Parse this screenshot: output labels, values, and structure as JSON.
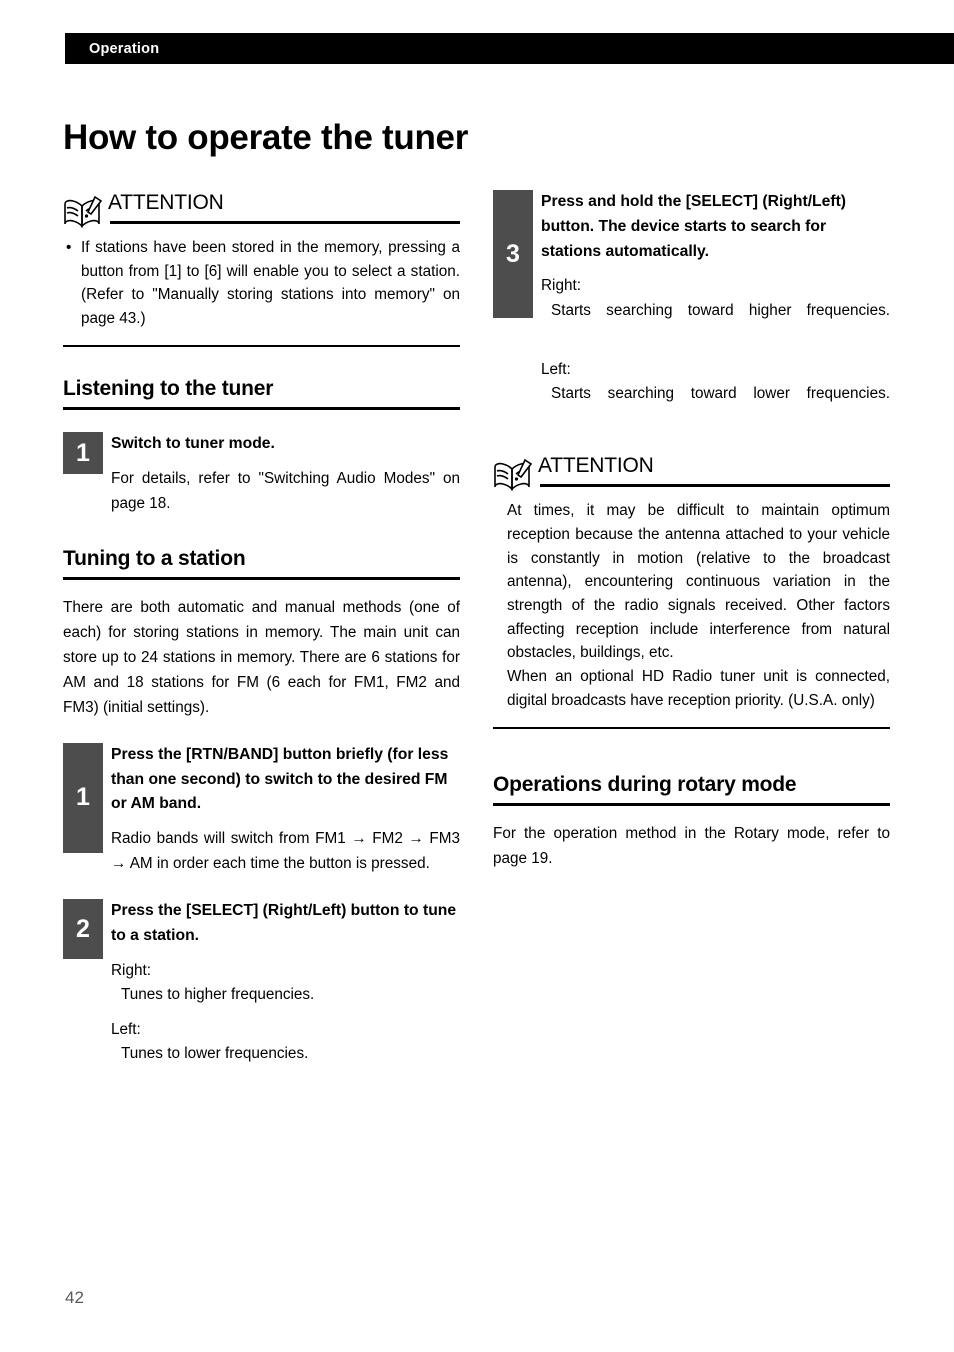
{
  "runhead": {
    "label": "Operation"
  },
  "page_title": "How to operate the tuner",
  "page_number": "42",
  "icons": {
    "attention": "open-book-exclamation-icon"
  },
  "left_column": {
    "attention": {
      "heading": "ATTENTION",
      "bullet": "If stations have been stored in the memory, pressing a button from [1] to [6] will enable you to select a station. (Refer to \"Manually storing stations into memory\" on page 43.)"
    },
    "section_listening": {
      "title": "Listening to the tuner",
      "steps": [
        {
          "number": "1",
          "title": "Switch to tuner mode.",
          "text": "For details, refer to \"Switching Audio Modes\" on page 18."
        }
      ]
    },
    "section_tuning": {
      "title": "Tuning to a station",
      "intro": "There are both automatic and manual methods (one of each) for storing stations in memory. The main unit can store up to 24 stations in memory. There are 6 stations for AM and 18 stations for FM (6 each for FM1, FM2 and FM3) (initial settings).",
      "steps": [
        {
          "number": "1",
          "title": "Press the [RTN/BAND] button briefly (for less than one second) to switch to the desired FM or AM band.",
          "text": "Radio bands will switch from FM1 → FM2 → FM3 → AM in order each time the button is pressed."
        },
        {
          "number": "2",
          "title": "Press the [SELECT] (Right/Left) button to tune to a station.",
          "right_label": "Right:",
          "right_value": "Tunes to higher frequencies.",
          "left_label": "Left:",
          "left_value": "Tunes to lower frequencies."
        }
      ]
    }
  },
  "right_column": {
    "step3": {
      "number": "3",
      "title": "Press and hold the [SELECT] (Right/Left) button. The device starts to search for stations automatically.",
      "right_label": "Right:",
      "right_value": "Starts searching toward higher frequencies.",
      "left_label": "Left:",
      "left_value": "Starts searching toward lower frequencies."
    },
    "attention": {
      "heading": "ATTENTION",
      "paragraph_1": "At times, it may be difficult to maintain optimum reception because the antenna attached to your vehicle is constantly in motion (relative to the broadcast antenna), encountering continuous variation in the strength of the radio signals received. Other factors affecting reception include interference from natural obstacles, buildings, etc.",
      "paragraph_2": "When an optional HD Radio tuner unit is connected, digital broadcasts have reception priority. (U.S.A. only)"
    },
    "section_rotary": {
      "title": "Operations during rotary mode",
      "text": "For the operation method in the Rotary mode, refer to page 19."
    }
  },
  "colors": {
    "runhead_bar": "#000000",
    "step_box": "#4d4d4d",
    "rule": "#000000",
    "page_number": "#58595b"
  }
}
